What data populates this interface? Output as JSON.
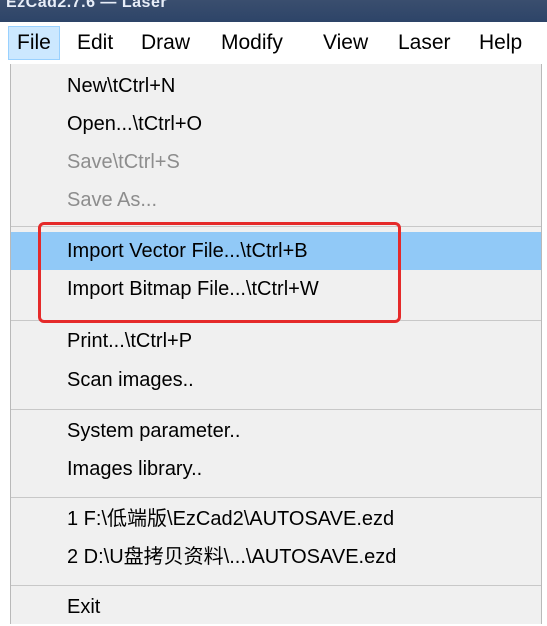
{
  "window": {
    "title": "EzCad2.7.6 — Laser"
  },
  "menubar": {
    "items": [
      {
        "label": "File",
        "active": true
      },
      {
        "label": "Edit"
      },
      {
        "label": "Draw"
      },
      {
        "label": "Modify"
      },
      {
        "label": "View"
      },
      {
        "label": "Laser"
      },
      {
        "label": "Help"
      }
    ]
  },
  "file_menu": {
    "new": "New\\tCtrl+N",
    "open": "Open...\\tCtrl+O",
    "save": "Save\\tCtrl+S",
    "save_as": "Save As...",
    "import_vector": "Import Vector File...\\tCtrl+B",
    "import_bitmap": "Import Bitmap File...\\tCtrl+W",
    "print": "Print...\\tCtrl+P",
    "scan_images": "Scan images..",
    "system_parameter": "System parameter..",
    "images_library": "Images library..",
    "recent_1": "1 F:\\低端版\\EzCad2\\AUTOSAVE.ezd",
    "recent_2": "2 D:\\U盘拷贝资料\\...\\AUTOSAVE.ezd",
    "exit": "Exit"
  },
  "colors": {
    "highlight": "#91c9f7",
    "annotation_box": "#e52a2a",
    "menu_background": "#f0f0f0",
    "disabled_text": "#8d8d8d"
  }
}
